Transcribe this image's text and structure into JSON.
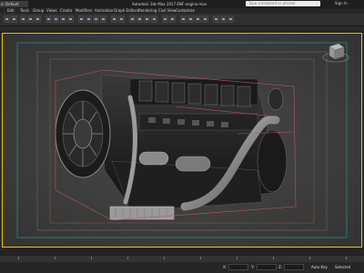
{
  "titlebar": {
    "workspace": "e: Default",
    "app_title": "Autodesk 3ds Max 2017    ENF engine.max",
    "search_placeholder": "Type a keyword or phrase",
    "user": "Sign In"
  },
  "menubar": {
    "items": [
      "Edit",
      "Tools",
      "Group",
      "Views",
      "Create",
      "Modifiers",
      "Animation",
      "Graph Editors",
      "Rendering",
      "Civil View",
      "Customize"
    ]
  },
  "viewport": {
    "label": "[+] [Perspective] [User Defined] [Default Shading]"
  },
  "status": {
    "x_label": "X:",
    "y_label": "Y:",
    "z_label": "Z:",
    "key_filter_label": "Auto Key",
    "selected_label": "Selected"
  },
  "colors": {
    "viewport_border": "#f0c000",
    "safe_frame": "#2a8a8a",
    "selection_lines": "#c05070"
  }
}
